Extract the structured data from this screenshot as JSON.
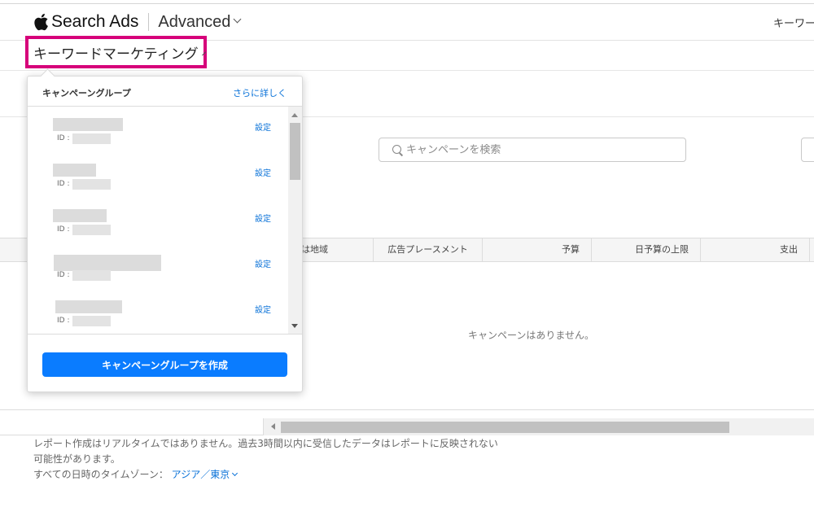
{
  "header": {
    "brand": "Search Ads",
    "product": "Advanced",
    "account_menu": "キーワー"
  },
  "org_selector": {
    "label": "キーワードマーケティング"
  },
  "campaign_group_popup": {
    "title": "キャンペーングループ",
    "more_link": "さらに詳しく",
    "items": [
      {
        "id_label": "ID :",
        "setting": "設定"
      },
      {
        "id_label": "ID :",
        "setting": "設定"
      },
      {
        "id_label": "ID :",
        "setting": "設定"
      },
      {
        "id_label": "ID :",
        "setting": "設定"
      },
      {
        "id_label": "ID :",
        "setting": "設定"
      }
    ],
    "create_button": "キャンペーングループを作成"
  },
  "search": {
    "placeholder": "キャンペーンを検索"
  },
  "table": {
    "columns": [
      "は地域",
      "広告プレースメント",
      "予算",
      "日予算の上限",
      "支出"
    ],
    "empty_message": "キャンペーンはありません。"
  },
  "footer": {
    "note_line1": "レポート作成はリアルタイムではありません。過去3時間以内に受信したデータはレポートに反映されない",
    "note_line2": "可能性があります。",
    "timezone_label": "すべての日時のタイムゾーン：",
    "timezone_value": "アジア／東京"
  },
  "colors": {
    "highlight": "#d6007a",
    "accent": "#0a7cff",
    "link": "#0a72d8"
  }
}
